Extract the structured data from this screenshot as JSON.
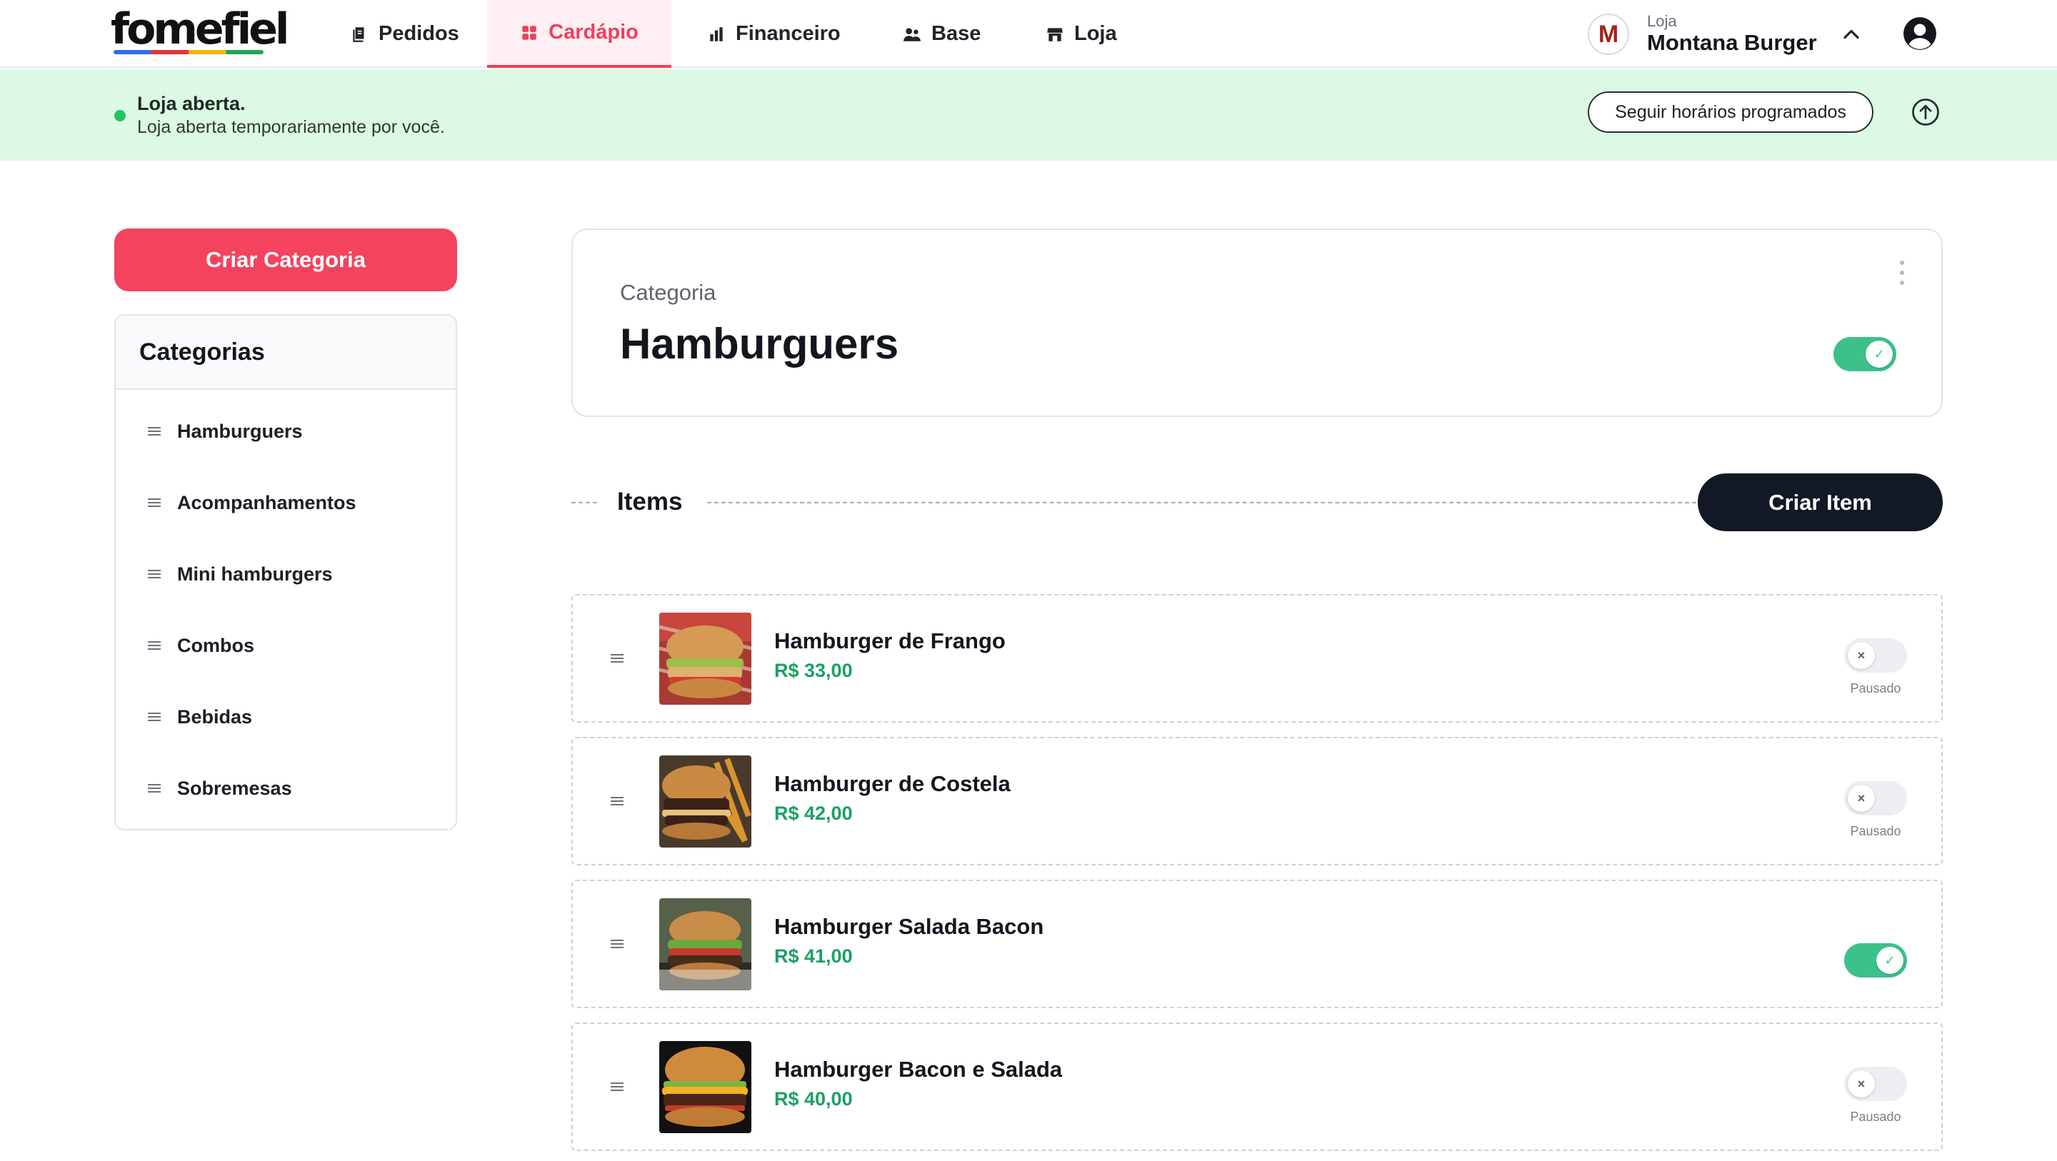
{
  "brand": {
    "logo": "fomefiel"
  },
  "nav": {
    "items": [
      {
        "label": "Pedidos",
        "icon": "orders-icon"
      },
      {
        "label": "Cardápio",
        "icon": "menu-grid-icon",
        "active": true
      },
      {
        "label": "Financeiro",
        "icon": "bar-chart-icon"
      },
      {
        "label": "Base",
        "icon": "users-icon"
      },
      {
        "label": "Loja",
        "icon": "store-icon"
      }
    ],
    "active_color": "#ef3f5d"
  },
  "store": {
    "caption": "Loja",
    "name": "Montana Burger",
    "avatar_letter": "M"
  },
  "banner": {
    "title": "Loja aberta.",
    "subtitle": "Loja aberta temporariamente por você.",
    "schedule_button": "Seguir horários programados",
    "status_color": "#22c55e"
  },
  "sidebar": {
    "create_button": "Criar Categoria",
    "header": "Categorias",
    "categories": [
      "Hamburguers",
      "Acompanhamentos",
      "Mini hamburgers",
      "Combos",
      "Bebidas",
      "Sobremesas"
    ]
  },
  "category": {
    "label": "Categoria",
    "title": "Hamburguers",
    "enabled": true
  },
  "items_section": {
    "title": "Items",
    "create_button": "Criar Item"
  },
  "items": [
    {
      "name": "Hamburger de Frango",
      "price": "R$ 33,00",
      "enabled": false,
      "status": "Pausado"
    },
    {
      "name": "Hamburger de Costela",
      "price": "R$ 42,00",
      "enabled": false,
      "status": "Pausado"
    },
    {
      "name": "Hamburger Salada Bacon",
      "price": "R$ 41,00",
      "enabled": true,
      "status": ""
    },
    {
      "name": "Hamburger Bacon e Salada",
      "price": "R$ 40,00",
      "enabled": false,
      "status": "Pausado"
    }
  ],
  "colors": {
    "primary": "#f3435f",
    "dark": "#121826",
    "price": "#1aa064",
    "toggle_on": "#3cc18a"
  }
}
